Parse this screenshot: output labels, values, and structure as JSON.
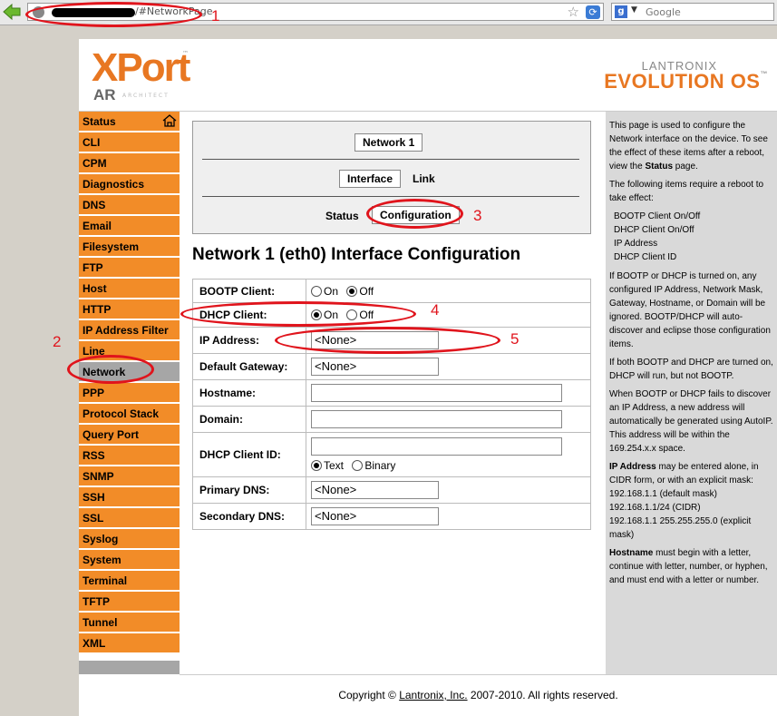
{
  "browser": {
    "url_text": "/#NetworkPage",
    "search_placeholder": "Google",
    "search_engine_icon": "google-icon"
  },
  "header": {
    "logo_word": "XPort",
    "logo_sub": "AR",
    "logo_sub_tag": "ARCHITECT",
    "brand_top": "LANTRONIX",
    "brand_main": "EVOLUTION OS"
  },
  "sidebar": {
    "items": [
      {
        "label": "Status"
      },
      {
        "label": "CLI"
      },
      {
        "label": "CPM"
      },
      {
        "label": "Diagnostics"
      },
      {
        "label": "DNS"
      },
      {
        "label": "Email"
      },
      {
        "label": "Filesystem"
      },
      {
        "label": "FTP"
      },
      {
        "label": "Host"
      },
      {
        "label": "HTTP"
      },
      {
        "label": "IP Address Filter"
      },
      {
        "label": "Line"
      },
      {
        "label": "Network"
      },
      {
        "label": "PPP"
      },
      {
        "label": "Protocol Stack"
      },
      {
        "label": "Query Port"
      },
      {
        "label": "RSS"
      },
      {
        "label": "SNMP"
      },
      {
        "label": "SSH"
      },
      {
        "label": "SSL"
      },
      {
        "label": "Syslog"
      },
      {
        "label": "System"
      },
      {
        "label": "Terminal"
      },
      {
        "label": "TFTP"
      },
      {
        "label": "Tunnel"
      },
      {
        "label": "XML"
      }
    ],
    "active": "Network"
  },
  "tabs": {
    "network": "Network 1",
    "interface": "Interface",
    "link": "Link",
    "status": "Status",
    "configuration": "Configuration"
  },
  "main": {
    "title": "Network 1 (eth0) Interface Configuration",
    "rows": {
      "bootp": {
        "label": "BOOTP Client:",
        "on": "On",
        "off": "Off",
        "selected": "Off"
      },
      "dhcp": {
        "label": "DHCP Client:",
        "on": "On",
        "off": "Off",
        "selected": "On"
      },
      "ip": {
        "label": "IP Address:",
        "value": "<None>"
      },
      "gateway": {
        "label": "Default Gateway:",
        "value": "<None>"
      },
      "hostname": {
        "label": "Hostname:",
        "value": ""
      },
      "domain": {
        "label": "Domain:",
        "value": ""
      },
      "dhcp_id": {
        "label": "DHCP Client ID:",
        "value": "",
        "text": "Text",
        "binary": "Binary",
        "selected": "Text"
      },
      "pdns": {
        "label": "Primary DNS:",
        "value": "<None>"
      },
      "sdns": {
        "label": "Secondary DNS:",
        "value": "<None>"
      }
    }
  },
  "help": {
    "p1_a": "This page is used to configure the Network interface on the device. To see the effect of these items after a reboot, view the ",
    "p1_b": "Status",
    "p1_c": " page.",
    "p2": "The following items require a reboot to take effect:",
    "list": [
      "BOOTP Client On/Off",
      "DHCP Client On/Off",
      "IP Address",
      "DHCP Client ID"
    ],
    "p3": "If BOOTP or DHCP is turned on, any configured IP Address, Network Mask, Gateway, Hostname, or Domain will be ignored. BOOTP/DHCP will auto-discover and eclipse those configuration items.",
    "p4": "If both BOOTP and DHCP are turned on, DHCP will run, but not BOOTP.",
    "p5": "When BOOTP or DHCP fails to discover an IP Address, a new address will automatically be generated using AutoIP. This address will be within the 169.254.x.x space.",
    "p6_b": "IP Address",
    "p6_a": " may be entered alone, in CIDR form, or with an explicit mask:",
    "p6_l1": "192.168.1.1 (default mask)",
    "p6_l2": "192.168.1.1/24 (CIDR)",
    "p6_l3": "192.168.1.1 255.255.255.0 (explicit mask)",
    "p7_b": "Hostname",
    "p7_a": " must begin with a letter, continue with letter, number, or hyphen, and must end with a letter or number."
  },
  "footer": {
    "pre": "Copyright © ",
    "link": "Lantronix, Inc.",
    "post": " 2007-2010. All rights reserved."
  },
  "annotations": [
    "1",
    "2",
    "3",
    "4",
    "5"
  ],
  "colors": {
    "accent_orange": "#f28c28",
    "annotation_red": "#e0141c",
    "active_gray": "#a6a6a6"
  }
}
